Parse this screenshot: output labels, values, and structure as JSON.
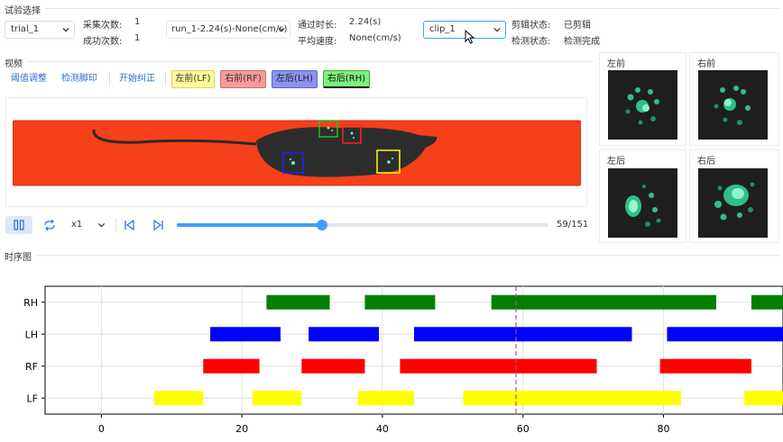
{
  "trial_section": {
    "title": "试验选择",
    "trial_select": "trial_1",
    "collect_count_label": "采集次数:",
    "collect_count_value": "1",
    "success_count_label": "成功次数:",
    "success_count_value": "1",
    "run_select": "run_1-2.24(s)-None(cm/s)",
    "pass_duration_label": "通过时长:",
    "pass_duration_value": "2.24(s)",
    "avg_speed_label": "平均速度:",
    "avg_speed_value": "None(cm/s)",
    "clip_select": "clip_1",
    "clip_status_label": "剪辑状态:",
    "clip_status_value": "已剪辑",
    "detect_status_label": "检测状态:",
    "detect_status_value": "检测完成"
  },
  "video_section": {
    "title": "视频",
    "buttons": {
      "threshold": "阈值调整",
      "detect_paw": "检测脚印",
      "start_correct": "开始纠正",
      "lf": "左前(LF)",
      "rf": "右前(RF)",
      "lh": "左后(LH)",
      "rh": "右后(RH)"
    },
    "speed": "x1",
    "frame_counter": "59/151",
    "progress": 0.39,
    "paw_colors": {
      "lf": "#ffff00",
      "rf": "#ff2020",
      "lh": "#2020ff",
      "rh": "#20c020"
    }
  },
  "thumbnails": {
    "front_left": "左前",
    "front_right": "右前",
    "hind_left": "左后",
    "hind_right": "右后"
  },
  "timeline": {
    "title": "时序图",
    "current_frame": 59
  },
  "chart_data": {
    "type": "gantt",
    "xlim": [
      -8,
      97
    ],
    "xticks": [
      0,
      20,
      40,
      60,
      80
    ],
    "categories": [
      "RH",
      "LH",
      "RF",
      "LF"
    ],
    "marker_x": 59,
    "series": [
      {
        "name": "RH",
        "color": "#008000",
        "spans": [
          [
            23.5,
            32.5
          ],
          [
            37.5,
            47.5
          ],
          [
            55.5,
            87.5
          ],
          [
            92.5,
            97
          ]
        ]
      },
      {
        "name": "LH",
        "color": "#0000ff",
        "spans": [
          [
            15.5,
            25.5
          ],
          [
            29.5,
            39.5
          ],
          [
            44.5,
            75.5
          ],
          [
            80.5,
            97
          ]
        ]
      },
      {
        "name": "RF",
        "color": "#ff0000",
        "spans": [
          [
            14.5,
            22.5
          ],
          [
            28.5,
            37.5
          ],
          [
            42.5,
            70.5
          ],
          [
            79.5,
            92.5
          ]
        ]
      },
      {
        "name": "LF",
        "color": "#ffff00",
        "spans": [
          [
            7.5,
            14.5
          ],
          [
            21.5,
            28.5
          ],
          [
            36.5,
            44.5
          ],
          [
            51.5,
            82.5
          ],
          [
            91.5,
            97
          ]
        ]
      }
    ]
  }
}
